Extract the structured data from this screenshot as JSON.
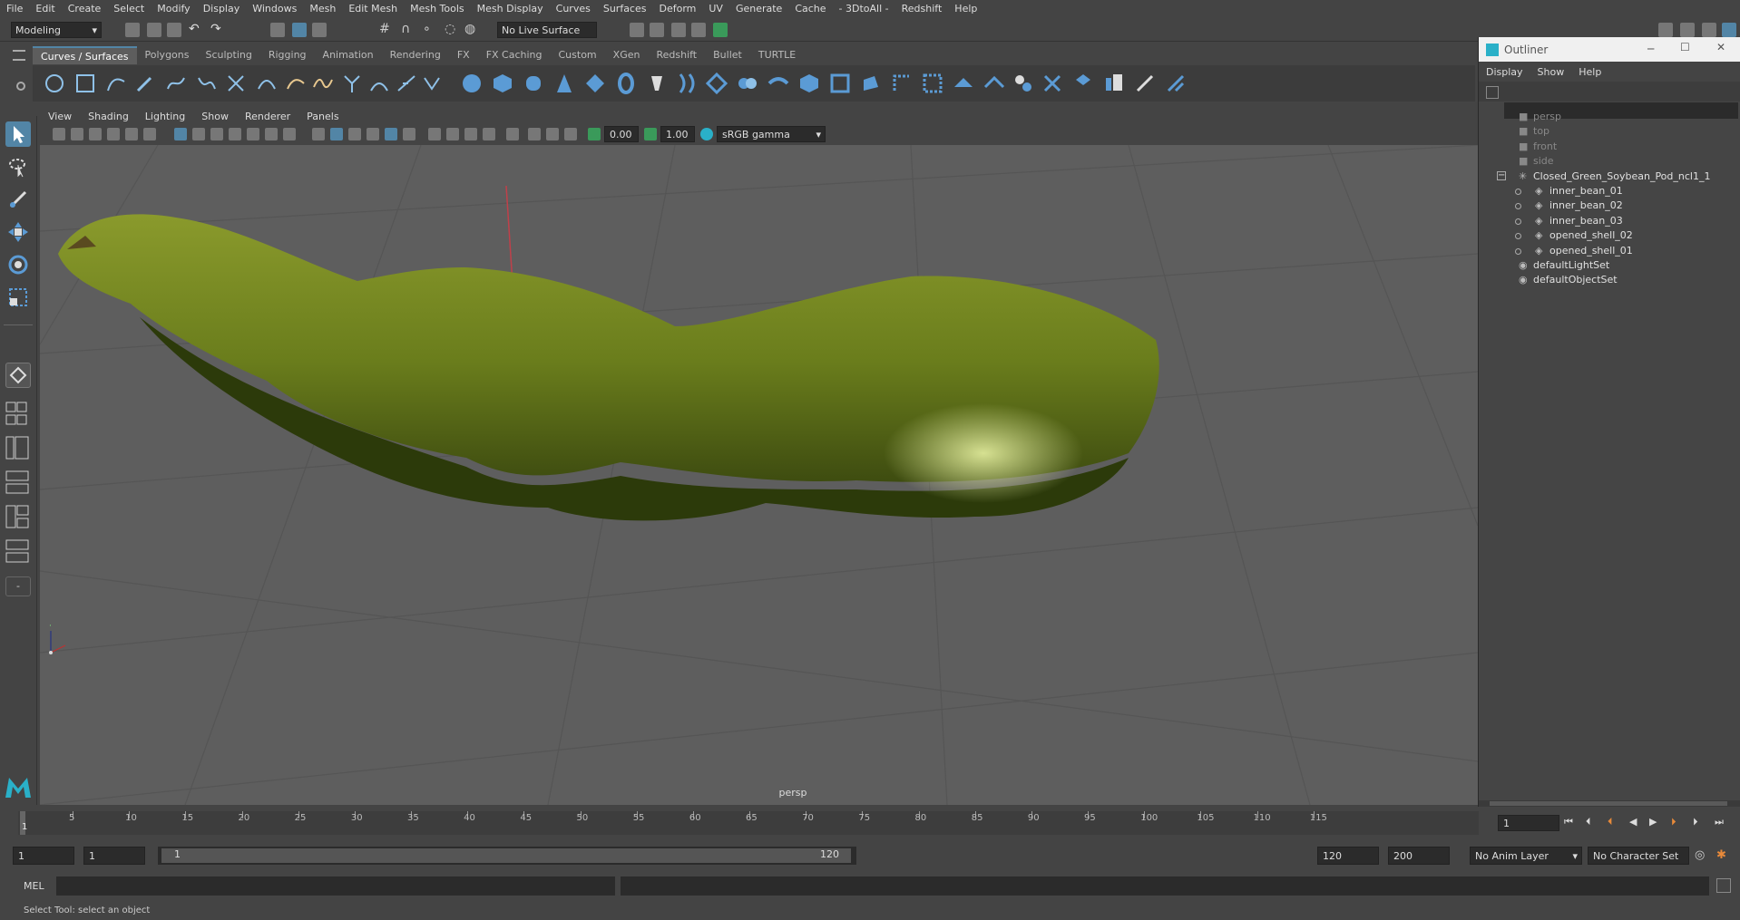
{
  "menubar": {
    "items": [
      "File",
      "Edit",
      "Create",
      "Select",
      "Modify",
      "Display",
      "Windows",
      "Mesh",
      "Edit Mesh",
      "Mesh Tools",
      "Mesh Display",
      "Curves",
      "Surfaces",
      "Deform",
      "UV",
      "Generate",
      "Cache",
      "- 3DtoAll -",
      "Redshift",
      "Help"
    ]
  },
  "status_line": {
    "mode": "Modeling",
    "live_surface": "No Live Surface"
  },
  "shelf": {
    "tabs": [
      "Curves / Surfaces",
      "Polygons",
      "Sculpting",
      "Rigging",
      "Animation",
      "Rendering",
      "FX",
      "FX Caching",
      "Custom",
      "XGen",
      "Redshift",
      "Bullet",
      "TURTLE"
    ],
    "active_tab": "Curves / Surfaces"
  },
  "viewport": {
    "menu": [
      "View",
      "Shading",
      "Lighting",
      "Show",
      "Renderer",
      "Panels"
    ],
    "exposure": "0.00",
    "gamma": "1.00",
    "color_space": "sRGB gamma",
    "camera_label": "persp"
  },
  "outliner": {
    "title": "Outliner",
    "menu": [
      "Display",
      "Show",
      "Help"
    ],
    "items": [
      {
        "label": "persp",
        "depth": 0,
        "dim": true,
        "icon": "camera-icon"
      },
      {
        "label": "top",
        "depth": 0,
        "dim": true,
        "icon": "camera-icon"
      },
      {
        "label": "front",
        "depth": 0,
        "dim": true,
        "icon": "camera-icon"
      },
      {
        "label": "side",
        "depth": 0,
        "dim": true,
        "icon": "camera-icon"
      },
      {
        "label": "Closed_Green_Soybean_Pod_ncl1_1",
        "depth": 0,
        "dim": false,
        "icon": "group-icon",
        "expanded": true
      },
      {
        "label": "inner_bean_01",
        "depth": 1,
        "dim": false,
        "icon": "mesh-icon"
      },
      {
        "label": "inner_bean_02",
        "depth": 1,
        "dim": false,
        "icon": "mesh-icon"
      },
      {
        "label": "inner_bean_03",
        "depth": 1,
        "dim": false,
        "icon": "mesh-icon"
      },
      {
        "label": "opened_shell_02",
        "depth": 1,
        "dim": false,
        "icon": "mesh-icon"
      },
      {
        "label": "opened_shell_01",
        "depth": 1,
        "dim": false,
        "icon": "mesh-icon"
      },
      {
        "label": "defaultLightSet",
        "depth": 0,
        "dim": false,
        "icon": "set-icon"
      },
      {
        "label": "defaultObjectSet",
        "depth": 0,
        "dim": false,
        "icon": "set-icon"
      }
    ]
  },
  "timeline": {
    "ticks": [
      "5",
      "10",
      "15",
      "20",
      "25",
      "30",
      "35",
      "40",
      "45",
      "50",
      "55",
      "60",
      "65",
      "70",
      "75",
      "80",
      "85",
      "90",
      "95",
      "100",
      "105",
      "110",
      "115"
    ],
    "current_marker": "1",
    "current_frame": "1"
  },
  "range": {
    "start": "1",
    "current": "1",
    "slider_start": "1",
    "slider_end": "120",
    "end": "120",
    "anim_end": "200",
    "anim_layer": "No Anim Layer",
    "character_set": "No Character Set"
  },
  "command": {
    "label": "MEL"
  },
  "help_line": "Select Tool: select an object"
}
